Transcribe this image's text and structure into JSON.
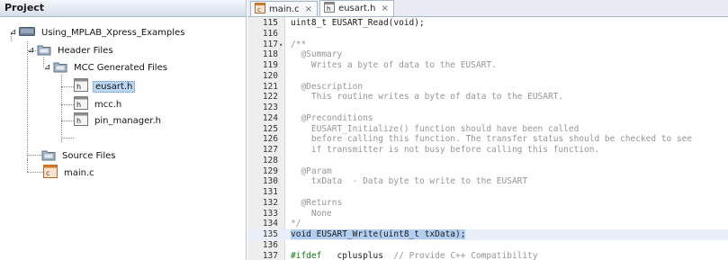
{
  "project": {
    "title": "Project",
    "tree": [
      {
        "id": "root",
        "label": "Using_MPLAB_Xpress_Examples",
        "expanded": true,
        "type": "project"
      },
      {
        "id": "header-files",
        "label": "Header Files",
        "expanded": true,
        "type": "folder"
      },
      {
        "id": "mcc-generated",
        "label": "MCC Generated Files",
        "expanded": true,
        "type": "folder"
      },
      {
        "id": "eusart-h",
        "label": "eusart.h",
        "type": "h-file",
        "selected": true
      },
      {
        "id": "mcc-h",
        "label": "mcc.h",
        "type": "h-file"
      },
      {
        "id": "pin-manager-h",
        "label": "pin_manager.h",
        "type": "h-file"
      },
      {
        "id": "source-files",
        "label": "Source Files",
        "expanded": true,
        "type": "folder"
      },
      {
        "id": "main-c",
        "label": "main.c",
        "type": "c-file"
      }
    ]
  },
  "editor": {
    "tabs": [
      {
        "label": "main.c",
        "close": "×",
        "active": false,
        "type": "c-file"
      },
      {
        "label": "eusart.h",
        "close": "×",
        "active": true,
        "type": "h-file"
      }
    ],
    "lines": [
      {
        "num": "115",
        "text": "uint8_t EUSART_Read(void);"
      },
      {
        "num": "116",
        "text": ""
      },
      {
        "num": "117",
        "text": "/**",
        "fold": "▾",
        "comment": true
      },
      {
        "num": "118",
        "text": "  @Summary",
        "comment": true
      },
      {
        "num": "119",
        "text": "    Writes a byte of data to the EUSART.",
        "comment": true
      },
      {
        "num": "120",
        "text": "",
        "comment": true
      },
      {
        "num": "121",
        "text": "  @Description",
        "comment": true
      },
      {
        "num": "122",
        "text": "    This routine writes a byte of data to the EUSART.",
        "comment": true
      },
      {
        "num": "123",
        "text": "",
        "comment": true
      },
      {
        "num": "124",
        "text": "  @Preconditions",
        "comment": true
      },
      {
        "num": "125",
        "text": "    EUSART_Initialize() function should have been called",
        "comment": true
      },
      {
        "num": "126",
        "text": "    before calling this function. The transfer status should be checked to see",
        "comment": true
      },
      {
        "num": "127",
        "text": "    if transmitter is not busy before calling this function.",
        "comment": true
      },
      {
        "num": "128",
        "text": "",
        "comment": true
      },
      {
        "num": "129",
        "text": "  @Param",
        "comment": true
      },
      {
        "num": "130",
        "text": "    txData  - Data byte to write to the EUSART",
        "comment": true
      },
      {
        "num": "131",
        "text": "",
        "comment": true
      },
      {
        "num": "132",
        "text": "  @Returns",
        "comment": true
      },
      {
        "num": "133",
        "text": "    None",
        "comment": true
      },
      {
        "num": "134",
        "text": "*/",
        "comment": true
      },
      {
        "num": "135",
        "text": "void EUSART_Write(uint8_t txData);",
        "highlight": true
      },
      {
        "num": "136",
        "text": ""
      },
      {
        "num": "137",
        "text": "#ifdef __cplusplus  // Provide C++ Compatibility"
      }
    ]
  },
  "colors": {
    "selection": "#b3cff0",
    "comment": "#969696",
    "keyword": "#0000e6",
    "preprocessor": "#0d7d0d"
  }
}
